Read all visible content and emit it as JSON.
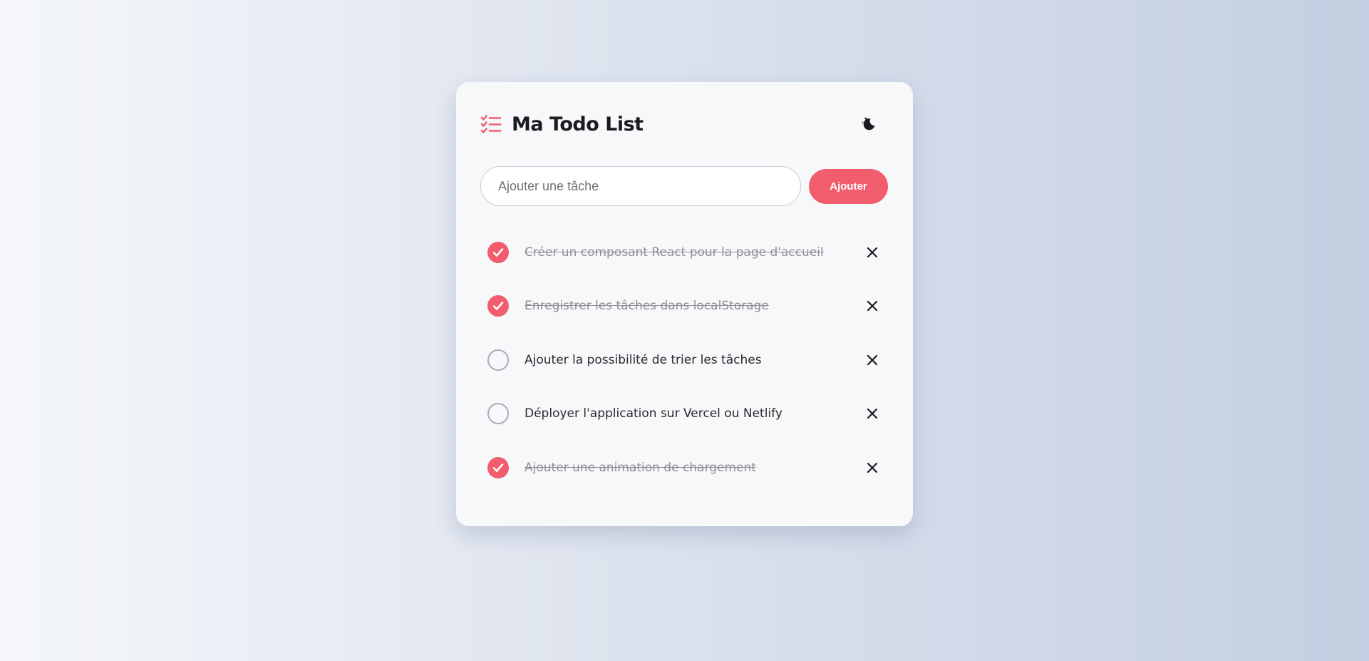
{
  "header": {
    "title": "Ma Todo List",
    "logo_icon": "checklist-icon",
    "theme_toggle_icon": "moon-stars-icon"
  },
  "add_form": {
    "placeholder": "Ajouter une tâche",
    "value": "",
    "button_label": "Ajouter"
  },
  "colors": {
    "accent": "#f25d6e",
    "card_background": "#f6f8fa",
    "text": "#1b1b1f",
    "completed_text": "#8e8e93"
  },
  "tasks": [
    {
      "label": "Créer un composant React pour la page d'accueil",
      "completed": true
    },
    {
      "label": "Enregistrer les tâches dans localStorage",
      "completed": true
    },
    {
      "label": "Ajouter la possibilité de trier les tâches",
      "completed": false
    },
    {
      "label": "Déployer l'application sur Vercel ou Netlify",
      "completed": false
    },
    {
      "label": "Ajouter une animation de chargement",
      "completed": true
    }
  ]
}
